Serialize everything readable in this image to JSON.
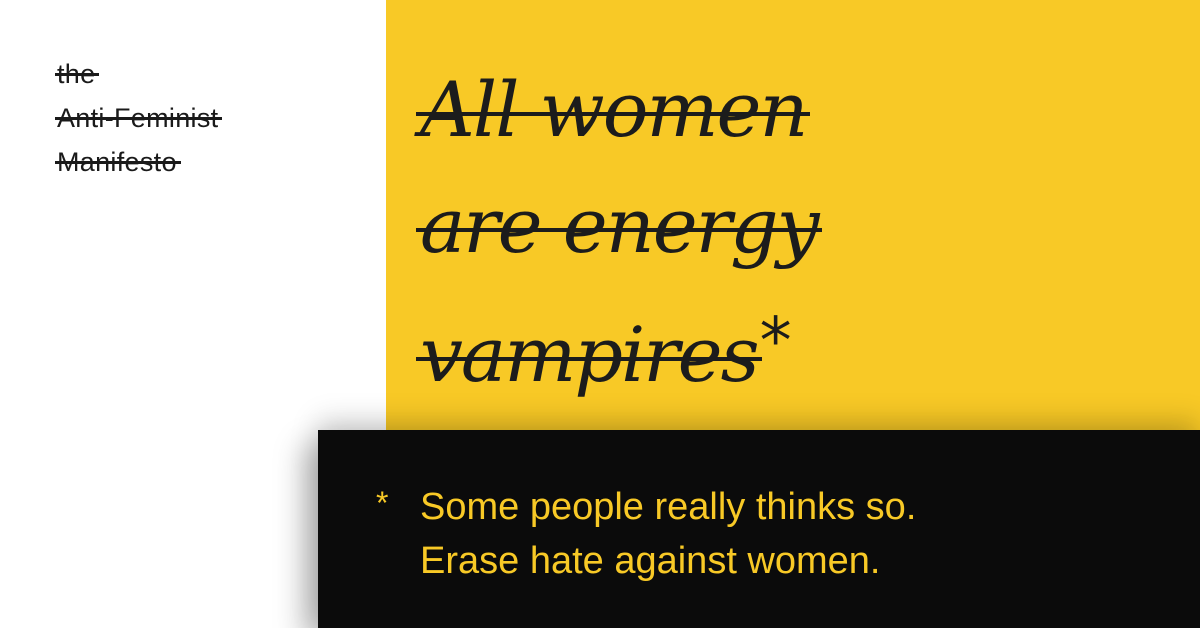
{
  "logo": {
    "line1": "the",
    "line2": "Anti-Feminist",
    "line3": "Manifesto"
  },
  "headline": {
    "line1": "All women",
    "line2": "are energy",
    "line3": "vampires",
    "asterisk": "*"
  },
  "footnote": {
    "mark": "*",
    "line1": "Some people really thinks so.",
    "line2": "Erase hate against women."
  },
  "colors": {
    "yellow": "#f8c926",
    "black": "#0b0b0b",
    "ink": "#1c1c1c",
    "white": "#ffffff"
  }
}
